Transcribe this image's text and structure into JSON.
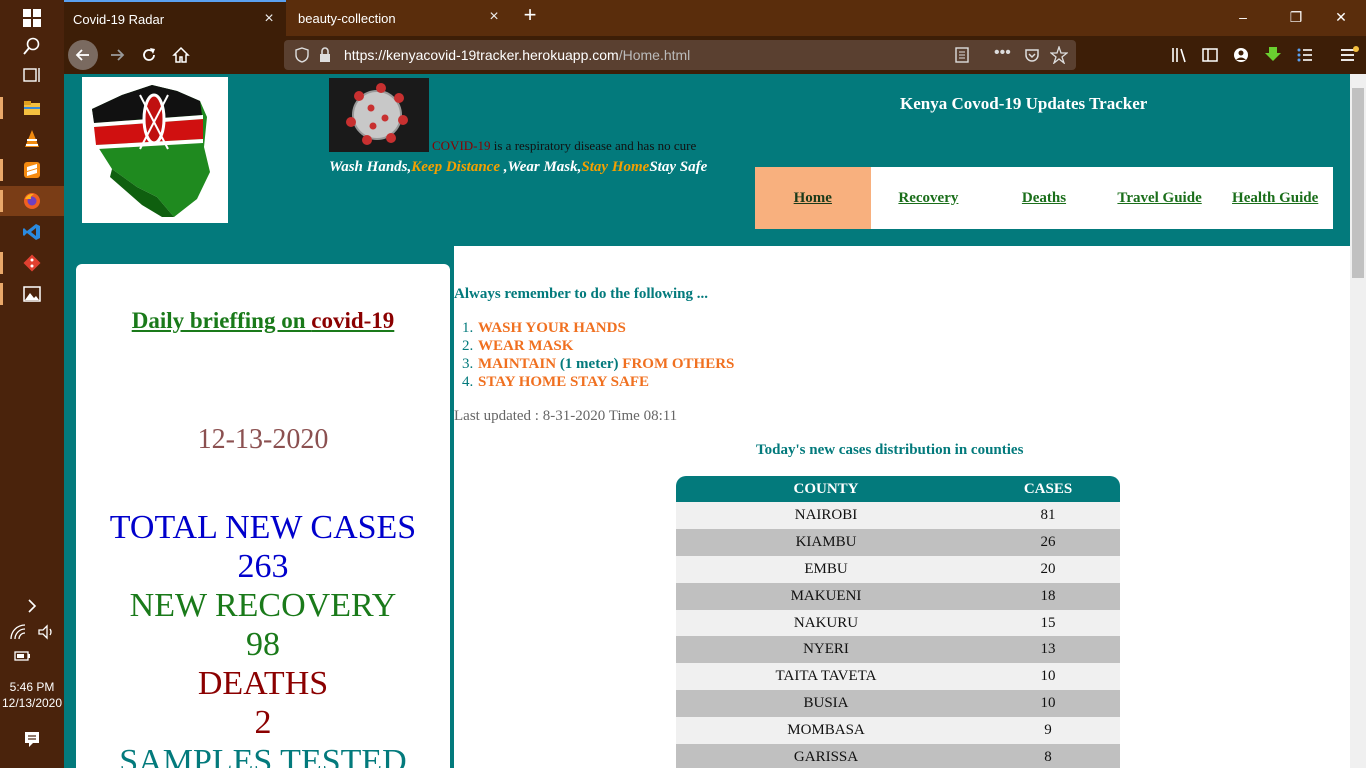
{
  "taskbar": {
    "time": "5:46 PM",
    "date": "12/13/2020"
  },
  "browser": {
    "tabs": [
      {
        "label": "Covid-19 Radar",
        "active": true
      },
      {
        "label": "beauty-collection",
        "active": false
      }
    ],
    "url_domain": "https://kenyacovid-19tracker.herokuapp.com",
    "url_path": "/Home.html"
  },
  "header": {
    "tagline_label": "COVID-19",
    "tagline_rest": " is a respiratory disease and has no cure",
    "slogan_1": "Wash Hands,",
    "slogan_2": "Keep Distance",
    "slogan_3": " ,Wear Mask,",
    "slogan_4": "Stay Home",
    "slogan_5": "Stay Safe",
    "site_title": "Kenya Covod-19 Updates Tracker",
    "menu": [
      "Home",
      "Recovery",
      "Deaths",
      "Travel Guide",
      "Health Guide"
    ]
  },
  "briefing": {
    "title_1": "Daily brieffing on ",
    "title_2": "covid-19",
    "date": "12-13-2020",
    "new_cases_label": "TOTAL NEW CASES",
    "new_cases": "263",
    "recovery_label": "NEW RECOVERY",
    "recovery": "98",
    "deaths_label": "DEATHS",
    "deaths": "2",
    "samples_label": "SAMPLES TESTED"
  },
  "content": {
    "remember": "Always remember to do the following ...",
    "todo": [
      {
        "num": "1.",
        "text": "WASH YOUR HANDS"
      },
      {
        "num": "2.",
        "text": "WEAR MASK"
      },
      {
        "num": "3.",
        "text_a": "MAINTAIN ",
        "text_b": "(1 meter)",
        "text_c": " FROM OTHERS"
      },
      {
        "num": "4.",
        "text": "STAY HOME STAY SAFE"
      }
    ],
    "updated": "Last updated : 8-31-2020 Time 08:11",
    "dist_title": "Today's new cases distribution in counties",
    "table_headers": [
      "COUNTY",
      "CASES"
    ],
    "table_rows": [
      [
        "NAIROBI",
        "81"
      ],
      [
        "KIAMBU",
        "26"
      ],
      [
        "EMBU",
        "20"
      ],
      [
        "MAKUENI",
        "18"
      ],
      [
        "NAKURU",
        "15"
      ],
      [
        "NYERI",
        "13"
      ],
      [
        "TAITA TAVETA",
        "10"
      ],
      [
        "BUSIA",
        "10"
      ],
      [
        "MOMBASA",
        "9"
      ],
      [
        "GARISSA",
        "8"
      ]
    ]
  },
  "colors": {
    "teal": "#037a7c",
    "orange": "#f07020",
    "menu_active": "#f8b07e",
    "green": "#1a7a1a",
    "dark_red": "#8b0000",
    "blue": "#0000cc"
  }
}
